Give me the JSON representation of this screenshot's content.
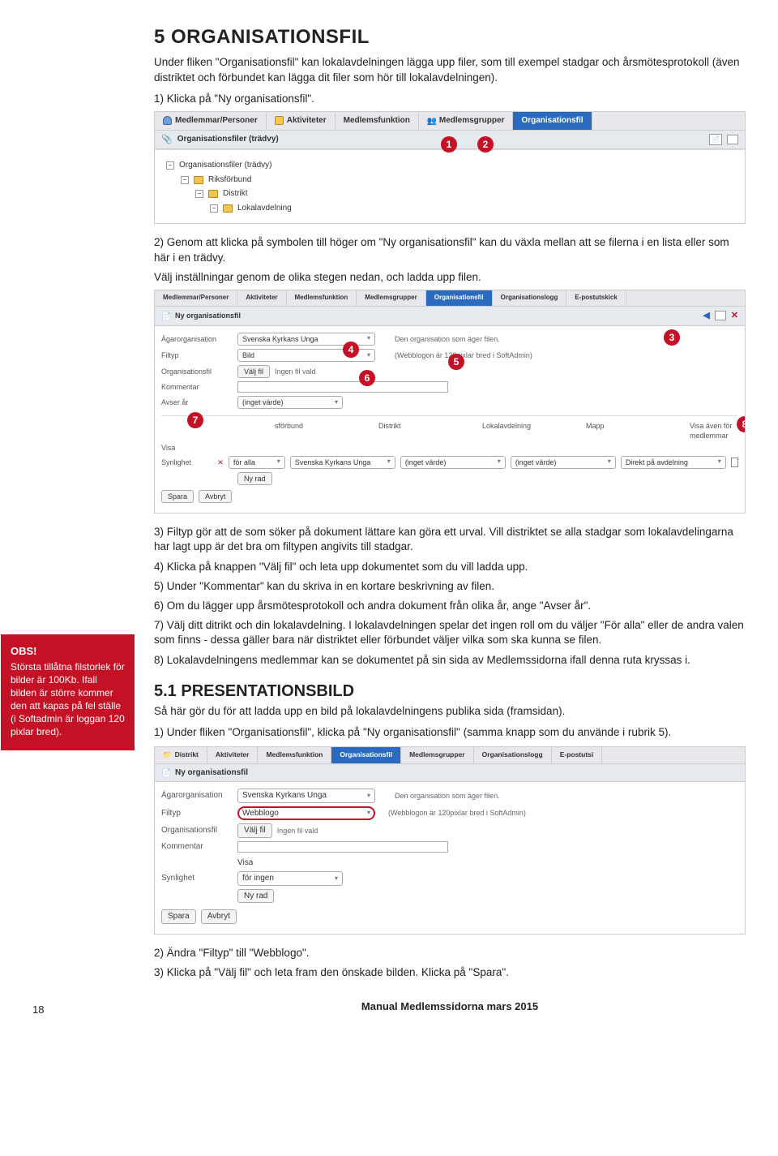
{
  "h1": "5 ORGANISATIONSFIL",
  "intro": "Under fliken \"Organisationsfil\" kan lokalavdelningen lägga upp filer, som till exempel stadgar och årsmötesprotokoll (även distriktet och förbundet kan lägga dit filer som hör till lokalavdelningen).",
  "step1": "1) Klicka på \"Ny organisationsfil\".",
  "shot1": {
    "tabs": [
      "Medlemmar/Personer",
      "Aktiviteter",
      "Medlemsfunktion",
      "Medlemsgrupper",
      "Organisationsfil"
    ],
    "subbar": "Organisationsfiler (trädvy)",
    "tree": {
      "root": "Organisationsfiler (trädvy)",
      "l1": "Riksförbund",
      "l2": "Distrikt",
      "l3": "Lokalavdelning"
    }
  },
  "step2a": "2) Genom att klicka på symbolen till höger om \"Ny organisationsfil\" kan du växla mellan att se filerna i en lista eller som här i en trädvy.",
  "step2b": "Välj inställningar genom de olika stegen nedan, och ladda upp filen.",
  "shot2": {
    "tabs": [
      "Medlemmar/Personer",
      "Aktiviteter",
      "Medlemsfunktion",
      "Medlemsgrupper",
      "Organisationsfil",
      "Organisationslogg",
      "E-postutskick"
    ],
    "title": "Ny organisationsfil",
    "labels": {
      "agaror": "Ägarorganisation",
      "filtyp": "Filtyp",
      "orgfil": "Organisationsfil",
      "kommentar": "Kommentar",
      "avser": "Avser år",
      "synlighet": "Synlighet"
    },
    "values": {
      "agaror": "Svenska Kyrkans Unga",
      "filtyp": "Bild",
      "valjfil": "Välj fil",
      "ingenfil": "Ingen fil vald",
      "avser": "(inget värde)",
      "visa": "Visa",
      "foralla": "för alla",
      "nyrad": "Ny rad",
      "spara": "Spara",
      "avbryt": "Avbryt"
    },
    "notes": {
      "n1": "Den organisation som äger filen.",
      "n2": "(Webblogon är 120pixlar bred i SoftAdmin)"
    },
    "cols": [
      "sförbund",
      "Distrikt",
      "Lokalavdelning",
      "Mapp"
    ],
    "row": [
      "Svenska Kyrkans Unga",
      "(inget värde)",
      "(inget värde)",
      "Direkt på avdelning"
    ],
    "sidecheck": "Visa även för medlemmar"
  },
  "obs_title": "OBS!",
  "obs_body": "Största tillåtna filstorlek för bilder är 100Kb. Ifall bilden är större kommer den att kapas på fel ställe (i Softadmin är loggan 120 pixlar bred).",
  "step3": "3) Filtyp gör att de som söker på dokument lättare kan göra ett urval. Vill distriktet se alla stadgar som lokalavdelingarna har lagt upp är det bra om filtypen angivits till stadgar.",
  "step4": "4) Klicka på knappen \"Välj fil\" och leta upp dokumentet som du vill ladda upp.",
  "step5": "5) Under \"Kommentar\" kan du skriva in en kortare beskrivning av filen.",
  "step6": "6) Om du lägger upp årsmötesprotokoll och andra dokument från olika år, ange \"Avser år\".",
  "step7": "7) Välj ditt ditrikt och din lokalavdelning. I lokalavdelningen spelar det ingen roll om du väljer \"För alla\" eller de andra valen som finns - dessa gäller bara när distriktet eller förbundet väljer vilka som ska kunna se filen.",
  "step8": "8) Lokalavdelningens medlemmar kan se dokumentet på sin sida av Medlemssidorna ifall denna ruta kryssas i.",
  "h2": "5.1 PRESENTATIONSBILD",
  "pres1": "Så här gör du för att ladda upp en bild på lokalavdelningens publika sida (framsidan).",
  "pres2": "1) Under fliken \"Organisationsfil\", klicka på \"Ny organisationsfil\" (samma knapp som du använde i rubrik 5).",
  "shot3": {
    "tabs": [
      "Distrikt",
      "Aktiviteter",
      "Medlemsfunktion",
      "Organisationsfil",
      "Medlemsgrupper",
      "Organisationslogg",
      "E-postutsi"
    ],
    "title": "Ny organisationsfil",
    "labels": {
      "agaror": "Ägarorganisation",
      "filtyp": "Filtyp",
      "orgfil": "Organisationsfil",
      "kommentar": "Kommentar",
      "synlighet": "Synlighet"
    },
    "values": {
      "agaror": "Svenska Kyrkans Unga",
      "filtyp": "Webblogo",
      "valjfil": "Välj fil",
      "ingenfil": "Ingen fil vald",
      "visa": "Visa",
      "foringen": "för ingen",
      "nyrad": "Ny rad",
      "spara": "Spara",
      "avbryt": "Avbryt"
    },
    "notes": {
      "n1": "Den organisation som äger filen.",
      "n2": "(Webblogon är 120pixlar bred i SoftAdmin)"
    }
  },
  "end2": "2) Ändra \"Filtyp\" till \"Webblogo\".",
  "end3": "3) Klicka på \"Välj fil\" och leta fram den önskade bilden. Klicka på \"Spara\".",
  "footer": "Manual Medlemssidorna mars 2015",
  "page_num": "18"
}
